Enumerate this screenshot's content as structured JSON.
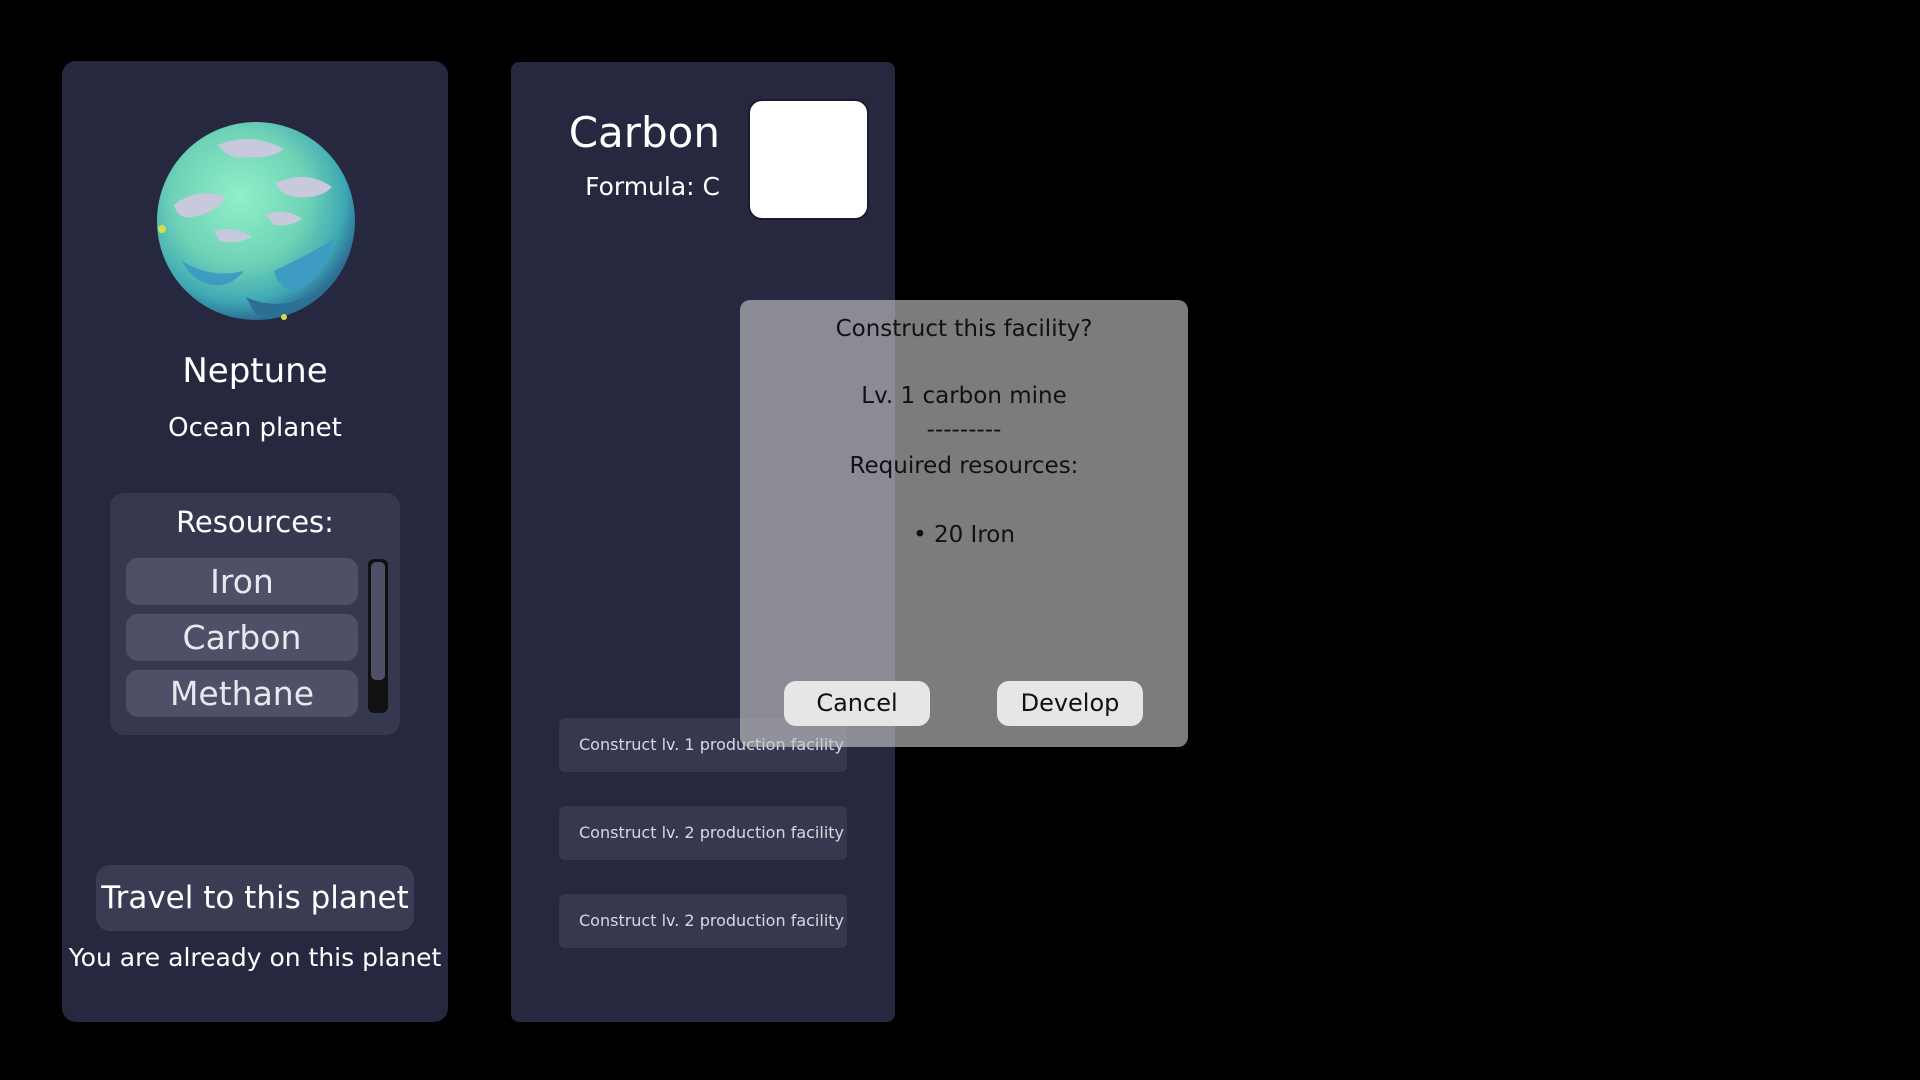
{
  "planet": {
    "name": "Neptune",
    "type": "Ocean planet",
    "resources_title": "Resources:",
    "resources": [
      "Iron",
      "Carbon",
      "Methane"
    ],
    "travel_label": "Travel to this planet",
    "status_note": "You are already on this planet"
  },
  "material": {
    "name": "Carbon",
    "formula": "Formula: C",
    "construct_buttons": [
      "Construct lv. 1 production facility",
      "Construct lv. 2 production facility",
      "Construct lv. 2 production facility"
    ]
  },
  "dialog": {
    "question": "Construct this facility?",
    "facility": "Lv. 1 carbon mine",
    "divider": "---------",
    "required_title": "Required resources:",
    "requirement": "• 20  Iron",
    "cancel_label": "Cancel",
    "develop_label": "Develop"
  },
  "colors": {
    "background": "#000000",
    "panel": "#262840",
    "planet_ocean": "#7fdcb8",
    "planet_cloud": "#c9c9dd"
  },
  "icons": {
    "planet": "ocean-planet-sprite"
  }
}
